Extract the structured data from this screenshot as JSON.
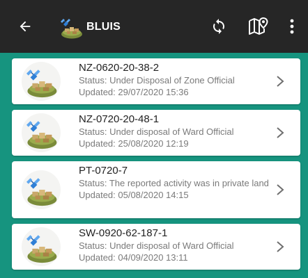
{
  "app": {
    "title": "BLUIS"
  },
  "toolbar": {
    "back_icon": "arrow-left-icon",
    "sync_icon": "sync-icon",
    "map_icon": "map-pin-icon",
    "more_icon": "more-vertical-icon"
  },
  "colors": {
    "appbar_bg": "#262626",
    "list_bg": "#16947f",
    "card_bg": "#ffffff",
    "primary_text": "#222222",
    "secondary_text": "#7a7a7a"
  },
  "cases": [
    {
      "code": "NZ-0620-20-38-2",
      "status": "Status: Under Disposal of Zone Official",
      "updated": "Updated: 29/07/2020 15:36"
    },
    {
      "code": "NZ-0720-20-48-1",
      "status": "Status: Under disposal of Ward Official",
      "updated": "Updated: 25/08/2020 12:19"
    },
    {
      "code": "PT-0720-7",
      "status": "Status: The reported activity was in private land",
      "updated": "Updated: 05/08/2020 14:15"
    },
    {
      "code": "SW-0920-62-187-1",
      "status": "Status: Under disposal of Ward Official",
      "updated": "Updated: 04/09/2020 13:11"
    }
  ]
}
